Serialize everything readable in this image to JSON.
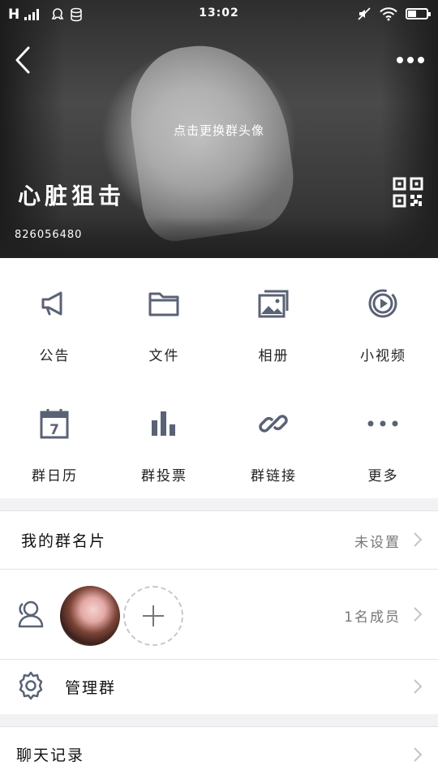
{
  "status_bar": {
    "network": "H",
    "time": "13:02"
  },
  "header": {
    "avatar_hint": "点击更换群头像",
    "group_name": "心脏狙击",
    "group_id": "826056480"
  },
  "features": [
    {
      "label": "公告",
      "icon": "megaphone-icon"
    },
    {
      "label": "文件",
      "icon": "folder-icon"
    },
    {
      "label": "相册",
      "icon": "album-icon"
    },
    {
      "label": "小视频",
      "icon": "video-icon"
    },
    {
      "label": "群日历",
      "icon": "calendar-icon"
    },
    {
      "label": "群投票",
      "icon": "poll-icon"
    },
    {
      "label": "群链接",
      "icon": "link-icon"
    },
    {
      "label": "更多",
      "icon": "more-dots-icon"
    }
  ],
  "calendar_day": "7",
  "card": {
    "title": "我的群名片",
    "value": "未设置"
  },
  "members": {
    "count_label": "1名成员"
  },
  "manage": {
    "title": "管理群"
  },
  "chat_history": {
    "title": "聊天记录"
  },
  "colors": {
    "icon": "#5a6275",
    "divider": "#e3e3e6",
    "background": "#f2f2f4"
  }
}
